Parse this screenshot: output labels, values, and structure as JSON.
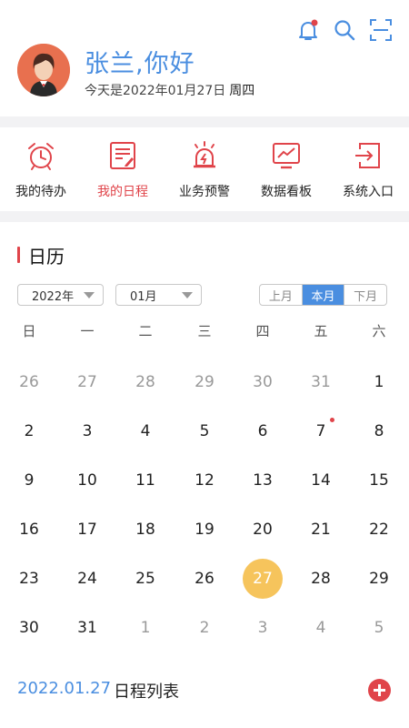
{
  "header": {
    "greeting": "张兰,你好",
    "date_prefix": "今天是2022年01月27日",
    "weekday": "周四",
    "icons": [
      "bell-icon",
      "search-icon",
      "scan-icon"
    ]
  },
  "quick_nav": [
    {
      "label": "我的待办",
      "icon": "alarm-clock-icon",
      "active": false
    },
    {
      "label": "我的日程",
      "icon": "document-edit-icon",
      "active": true
    },
    {
      "label": "业务预警",
      "icon": "warning-light-icon",
      "active": false
    },
    {
      "label": "数据看板",
      "icon": "chart-board-icon",
      "active": false
    },
    {
      "label": "系统入口",
      "icon": "login-entry-icon",
      "active": false
    }
  ],
  "calendar": {
    "title": "日历",
    "year_select": "2022年",
    "month_select": "01月",
    "range_tabs": [
      {
        "label": "上月",
        "active": false
      },
      {
        "label": "本月",
        "active": true
      },
      {
        "label": "下月",
        "active": false
      }
    ],
    "weekdays": [
      "日",
      "一",
      "二",
      "三",
      "四",
      "五",
      "六"
    ],
    "weeks": [
      [
        {
          "d": "26",
          "o": true
        },
        {
          "d": "27",
          "o": true
        },
        {
          "d": "28",
          "o": true
        },
        {
          "d": "29",
          "o": true
        },
        {
          "d": "30",
          "o": true
        },
        {
          "d": "31",
          "o": true
        },
        {
          "d": "1"
        }
      ],
      [
        {
          "d": "2"
        },
        {
          "d": "3"
        },
        {
          "d": "4"
        },
        {
          "d": "5"
        },
        {
          "d": "6"
        },
        {
          "d": "7",
          "dot": true
        },
        {
          "d": "8"
        }
      ],
      [
        {
          "d": "9"
        },
        {
          "d": "10"
        },
        {
          "d": "11"
        },
        {
          "d": "12"
        },
        {
          "d": "13"
        },
        {
          "d": "14"
        },
        {
          "d": "15"
        }
      ],
      [
        {
          "d": "16"
        },
        {
          "d": "17"
        },
        {
          "d": "18"
        },
        {
          "d": "19"
        },
        {
          "d": "20"
        },
        {
          "d": "21"
        },
        {
          "d": "22"
        }
      ],
      [
        {
          "d": "23"
        },
        {
          "d": "24"
        },
        {
          "d": "25"
        },
        {
          "d": "26"
        },
        {
          "d": "27",
          "today": true
        },
        {
          "d": "28"
        },
        {
          "d": "29"
        }
      ],
      [
        {
          "d": "30"
        },
        {
          "d": "31"
        },
        {
          "d": "1",
          "o": true
        },
        {
          "d": "2",
          "o": true
        },
        {
          "d": "3",
          "o": true
        },
        {
          "d": "4",
          "o": true
        },
        {
          "d": "5",
          "o": true
        }
      ]
    ]
  },
  "schedule": {
    "date": "2022.01.27",
    "label": "日程列表"
  },
  "colors": {
    "accent_blue": "#4a8ee0",
    "accent_red": "#e0444a",
    "today_yellow": "#f6c45c"
  }
}
